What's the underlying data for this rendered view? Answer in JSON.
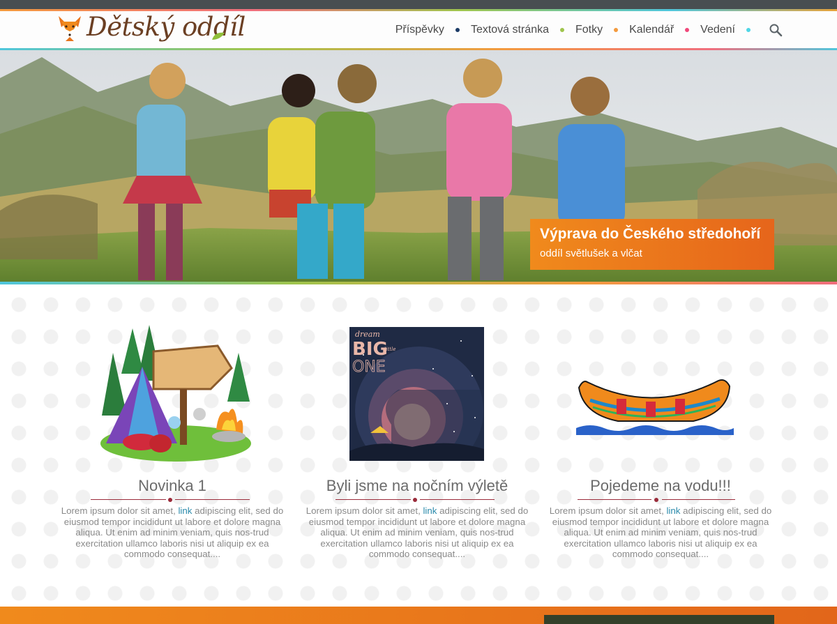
{
  "header": {
    "logo_text": "Dětský oddíl",
    "nav": [
      {
        "label": "Příspěvky",
        "dot_color": "#1c3b66"
      },
      {
        "label": "Textová stránka",
        "dot_color": "#9fc54d"
      },
      {
        "label": "Fotky",
        "dot_color": "#f39a3e"
      },
      {
        "label": "Kalendář",
        "dot_color": "#f0487a"
      },
      {
        "label": "Vedení",
        "dot_color": "#4fd6e6"
      }
    ],
    "search_icon": "search-icon"
  },
  "hero": {
    "title": "Výprava do Českého středohoří",
    "subtitle": "oddíl světlušek a vlčat"
  },
  "cards": [
    {
      "title": "Novinka 1",
      "text_before": "Lorem ipsum dolor sit amet, ",
      "link": "link",
      "text_after": " adipiscing elit, sed do eiusmod tempor incididunt ut labore et dolore magna aliqua. Ut enim ad minim veniam, quis nos-trud exercitation ullamco laboris nisi ut aliquip ex ea commodo consequat....",
      "image": "camping-tent-illustration"
    },
    {
      "title": "Byli jsme na nočním výletě",
      "text_before": "Lorem ipsum dolor sit amet, ",
      "link": "link",
      "text_after": " adipiscing elit, sed do eiusmod tempor incididunt ut labore et dolore magna aliqua. Ut enim ad minim veniam, quis nos-trud exercitation ullamco laboris nisi ut aliquip ex ea commodo consequat....",
      "image": "night-poster-illustration",
      "poster_text": {
        "small": "dream",
        "big": "BIG",
        "tiny": "little",
        "one": "ONE"
      }
    },
    {
      "title": "Pojedeme na vodu!!!",
      "text_before": "Lorem ipsum dolor sit amet, ",
      "link": "link",
      "text_after": " adipiscing elit, sed do eiusmod tempor incididunt ut labore et dolore magna aliqua. Ut enim ad minim veniam, quis nos-trud exercitation ullamco laboris nisi ut aliquip ex ea commodo consequat....",
      "image": "canoe-illustration"
    }
  ],
  "colors": {
    "accent_orange": "#f08a1c",
    "divider_red": "#9a2b3a",
    "link_blue": "#2a8aab"
  }
}
